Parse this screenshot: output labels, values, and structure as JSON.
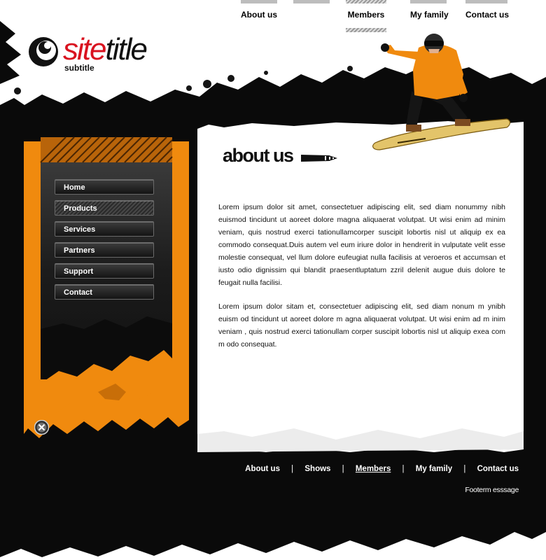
{
  "top_nav": {
    "items": [
      {
        "label": "About us"
      },
      {
        "label": ""
      },
      {
        "label": "Members"
      },
      {
        "label": "My family"
      },
      {
        "label": "Contact us"
      }
    ]
  },
  "logo": {
    "title_part1": "site",
    "title_part2": "title",
    "subtitle": "subtitle"
  },
  "side_nav": {
    "items": [
      {
        "label": "Home"
      },
      {
        "label": "Products"
      },
      {
        "label": "Services"
      },
      {
        "label": "Partners"
      },
      {
        "label": "Support"
      },
      {
        "label": "Contact"
      }
    ]
  },
  "content": {
    "heading": "about us",
    "paragraphs": [
      "Lorem ipsum dolor sit amet, consectetuer adipiscing elit, sed diam nonummy nibh euismod tincidunt ut aoreet dolore magna aliquaerat volutpat. Ut wisi enim ad minim veniam, quis nostrud exerci tationullamcorper suscipit lobortis nisl ut aliquip ex ea commodo consequat.Duis autem vel eum iriure dolor in hendrerit in vulputate velit esse molestie consequat, vel llum dolore eufeugiat nulla facilisis at veroeros et accumsan et iusto odio dignissim qui blandit praesentluptatum zzril delenit augue duis dolore te feugait nulla facilisi.",
      "Lorem ipsum dolor sitam et, consectetuer adipiscing elit, sed diam nonum m ynibh euism od tincidunt ut aoreet dolore m agna aliquaerat volutpat. Ut wisi enim ad m inim veniam , quis nostrud exerci tationullam corper suscipit lobortis nisl ut aliquip exea com m odo consequat."
    ]
  },
  "footer": {
    "links": [
      {
        "label": "About us"
      },
      {
        "label": "Shows"
      },
      {
        "label": "Members"
      },
      {
        "label": "My family"
      },
      {
        "label": "Contact us"
      }
    ],
    "separator": "|",
    "message": "Footerm esssage"
  },
  "colors": {
    "accent_orange": "#f08a0e",
    "logo_red": "#d9121f",
    "background_black": "#0a0a0a",
    "content_white": "#ffffff"
  }
}
